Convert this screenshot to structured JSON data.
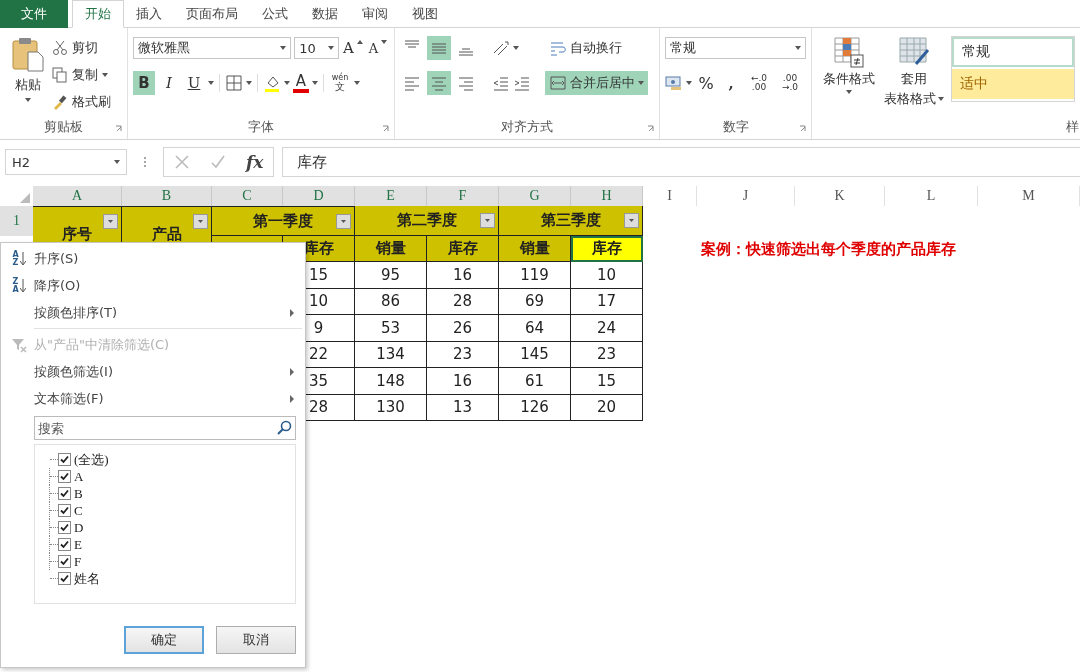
{
  "ribbon_tabs": [
    {
      "label": "文件",
      "kind": "file",
      "selected": false
    },
    {
      "label": "开始",
      "kind": "tab",
      "selected": true
    },
    {
      "label": "插入",
      "kind": "tab",
      "selected": false
    },
    {
      "label": "页面布局",
      "kind": "tab",
      "selected": false
    },
    {
      "label": "公式",
      "kind": "tab",
      "selected": false
    },
    {
      "label": "数据",
      "kind": "tab",
      "selected": false
    },
    {
      "label": "审阅",
      "kind": "tab",
      "selected": false
    },
    {
      "label": "视图",
      "kind": "tab",
      "selected": false
    }
  ],
  "clipboard": {
    "label": "剪贴板",
    "paste": "粘贴",
    "cut": "剪切",
    "copy": "复制",
    "format_painter": "格式刷"
  },
  "font": {
    "label": "字体",
    "font_name": "微软雅黑",
    "font_size": "10",
    "grow": "A",
    "shrink": "A",
    "bold": {
      "text": "B",
      "on": true
    },
    "italic": {
      "text": "I",
      "on": false
    },
    "underline": {
      "text": "U",
      "on": false
    },
    "font_color": "A",
    "phonetic": {
      "top": "wén",
      "bottom": "文"
    }
  },
  "alignment": {
    "label": "对齐方式",
    "vertical": [
      {
        "kind": "top",
        "selected": false
      },
      {
        "kind": "middle",
        "selected": true
      },
      {
        "kind": "bottom",
        "selected": false
      }
    ],
    "horizontal": [
      {
        "kind": "left",
        "selected": false
      },
      {
        "kind": "center",
        "selected": true
      },
      {
        "kind": "right",
        "selected": false
      }
    ],
    "wrap_text": "自动换行",
    "merge_center": {
      "text": "合并后居中",
      "on": true
    }
  },
  "number": {
    "label": "数字",
    "format": "常规",
    "percent": "%",
    "comma": ",",
    "decimal_increase": {
      "top": "←.0",
      "bottom": ".00"
    },
    "decimal_decrease": {
      "top": ".00",
      "bottom": "→.0"
    }
  },
  "styles": {
    "label": "样",
    "conditional_format": "条件格式",
    "table_format": [
      "套用",
      "表格格式"
    ],
    "cell_styles": [
      {
        "label": "常规",
        "kind": "normal"
      },
      {
        "label": "适中",
        "kind": "neutral"
      }
    ]
  },
  "formula_bar": {
    "name_box": "H2",
    "function_label": "fx",
    "formula": "库存"
  },
  "sheet": {
    "columns": [
      {
        "label": "A",
        "selected": true
      },
      {
        "label": "B",
        "selected": true
      },
      {
        "label": "C",
        "selected": true
      },
      {
        "label": "D",
        "selected": true
      },
      {
        "label": "E",
        "selected": true
      },
      {
        "label": "F",
        "selected": true
      },
      {
        "label": "G",
        "selected": true
      },
      {
        "label": "H",
        "selected": true
      },
      {
        "label": "I",
        "selected": false
      },
      {
        "label": "J",
        "selected": false
      },
      {
        "label": "K",
        "selected": false
      },
      {
        "label": "L",
        "selected": false
      },
      {
        "label": "M",
        "selected": false
      }
    ],
    "row_numbers": [
      {
        "label": "1",
        "selected": true
      }
    ],
    "header_row": [
      {
        "label": "序号",
        "filter": true
      },
      {
        "label": "产品",
        "filter": true
      },
      {
        "label": "第一季度",
        "filter": true
      },
      {
        "label": "第二季度",
        "filter": true
      },
      {
        "label": "第三季度",
        "filter": true
      }
    ],
    "sub_headers": [
      {
        "label": "库存",
        "selected": false
      },
      {
        "label": "销量",
        "selected": false
      },
      {
        "label": "库存",
        "selected": false
      },
      {
        "label": "销量",
        "selected": false
      },
      {
        "label": "库存",
        "selected": true
      }
    ],
    "rows": [
      [
        "",
        "",
        "",
        "15",
        "95",
        "16",
        "119",
        "10"
      ],
      [
        "",
        "",
        "",
        "10",
        "86",
        "28",
        "69",
        "17"
      ],
      [
        "",
        "",
        "",
        "9",
        "53",
        "26",
        "64",
        "24"
      ],
      [
        "",
        "",
        "",
        "22",
        "134",
        "23",
        "145",
        "23"
      ],
      [
        "",
        "",
        "",
        "35",
        "148",
        "16",
        "61",
        "15"
      ],
      [
        "",
        "",
        "",
        "28",
        "130",
        "13",
        "126",
        "20"
      ]
    ],
    "note": "案例：快速筛选出每个季度的产品库存"
  },
  "filter_menu": {
    "items": [
      {
        "label": "升序(S)",
        "kind": "sort",
        "icon_letters": "AZ",
        "disabled": false,
        "submenu": false
      },
      {
        "label": "降序(O)",
        "kind": "sort",
        "icon_letters": "ZA",
        "disabled": false,
        "submenu": false
      },
      {
        "label": "按颜色排序(T)",
        "kind": "plain",
        "disabled": false,
        "submenu": true
      },
      {
        "kind": "separator"
      },
      {
        "label": "从\"产品\"中清除筛选(C)",
        "kind": "clear",
        "disabled": true,
        "submenu": false
      },
      {
        "label": "按颜色筛选(I)",
        "kind": "plain",
        "disabled": false,
        "submenu": true
      },
      {
        "label": "文本筛选(F)",
        "kind": "plain",
        "disabled": false,
        "submenu": true
      }
    ],
    "search": {
      "placeholder": "搜索"
    },
    "values": [
      {
        "label": "(全选)",
        "checked": true
      },
      {
        "label": "A",
        "checked": true
      },
      {
        "label": "B",
        "checked": true
      },
      {
        "label": "C",
        "checked": true
      },
      {
        "label": "D",
        "checked": true
      },
      {
        "label": "E",
        "checked": true
      },
      {
        "label": "F",
        "checked": true
      },
      {
        "label": "姓名",
        "checked": true
      }
    ],
    "buttons": [
      {
        "label": "确定",
        "kind": "primary"
      },
      {
        "label": "取消",
        "kind": "secondary"
      }
    ]
  }
}
